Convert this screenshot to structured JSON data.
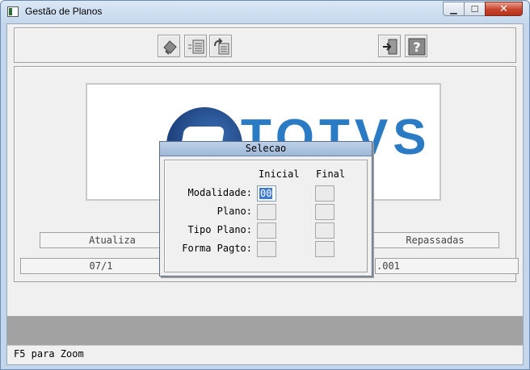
{
  "window": {
    "title": "Gestão de Planos"
  },
  "toolbar": {
    "buttons": [
      {
        "name": "confirm-icon"
      },
      {
        "name": "list-icon"
      },
      {
        "name": "copy-icon"
      },
      {
        "name": "exit-icon"
      },
      {
        "name": "help-icon"
      }
    ]
  },
  "logo": {
    "text": "TOTVS"
  },
  "main": {
    "left_header": "Atualiza",
    "right_header": "Repassadas",
    "left_value": "07/1",
    "right_value": ".001"
  },
  "dialog": {
    "title": "Selecao",
    "col_initial": "Inicial",
    "col_final": "Final",
    "rows": [
      {
        "label": "Modalidade:",
        "initial": "00",
        "final": ""
      },
      {
        "label": "Plano:",
        "initial": "",
        "final": ""
      },
      {
        "label": "Tipo Plano:",
        "initial": "",
        "final": ""
      },
      {
        "label": "Forma Pagto:",
        "initial": "",
        "final": ""
      }
    ]
  },
  "status": {
    "hint": "F5 para Zoom"
  },
  "colors": {
    "accent": "#2b7bc4",
    "selection": "#3d7bd4",
    "close_button": "#c7432b"
  }
}
